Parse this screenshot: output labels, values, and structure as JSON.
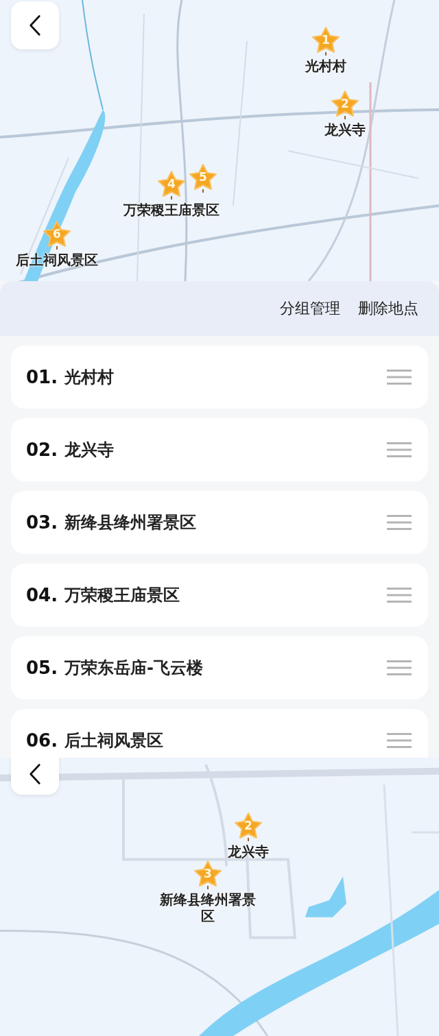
{
  "top_map": {
    "pins": [
      {
        "number": "1",
        "label": "光村村"
      },
      {
        "number": "2",
        "label": "龙兴寺"
      },
      {
        "number": "4",
        "label": "万荣稷王庙景区"
      },
      {
        "number": "5"
      },
      {
        "number": "6",
        "label": "后土祠风景区"
      }
    ]
  },
  "toolbar": {
    "actions": [
      "分组管理",
      "删除地点"
    ]
  },
  "places": [
    {
      "index": "01.",
      "name": "光村村"
    },
    {
      "index": "02.",
      "name": "龙兴寺"
    },
    {
      "index": "03.",
      "name": "新绛县绛州署景区"
    },
    {
      "index": "04.",
      "name": "万荣稷王庙景区"
    },
    {
      "index": "05.",
      "name": "万荣东岳庙-飞云楼"
    },
    {
      "index": "06.",
      "name": "后土祠风景区"
    }
  ],
  "bottom_map": {
    "pins": [
      {
        "number": "2",
        "label": "龙兴寺"
      },
      {
        "number": "3",
        "label": "新绛县绛州署景区"
      }
    ]
  }
}
